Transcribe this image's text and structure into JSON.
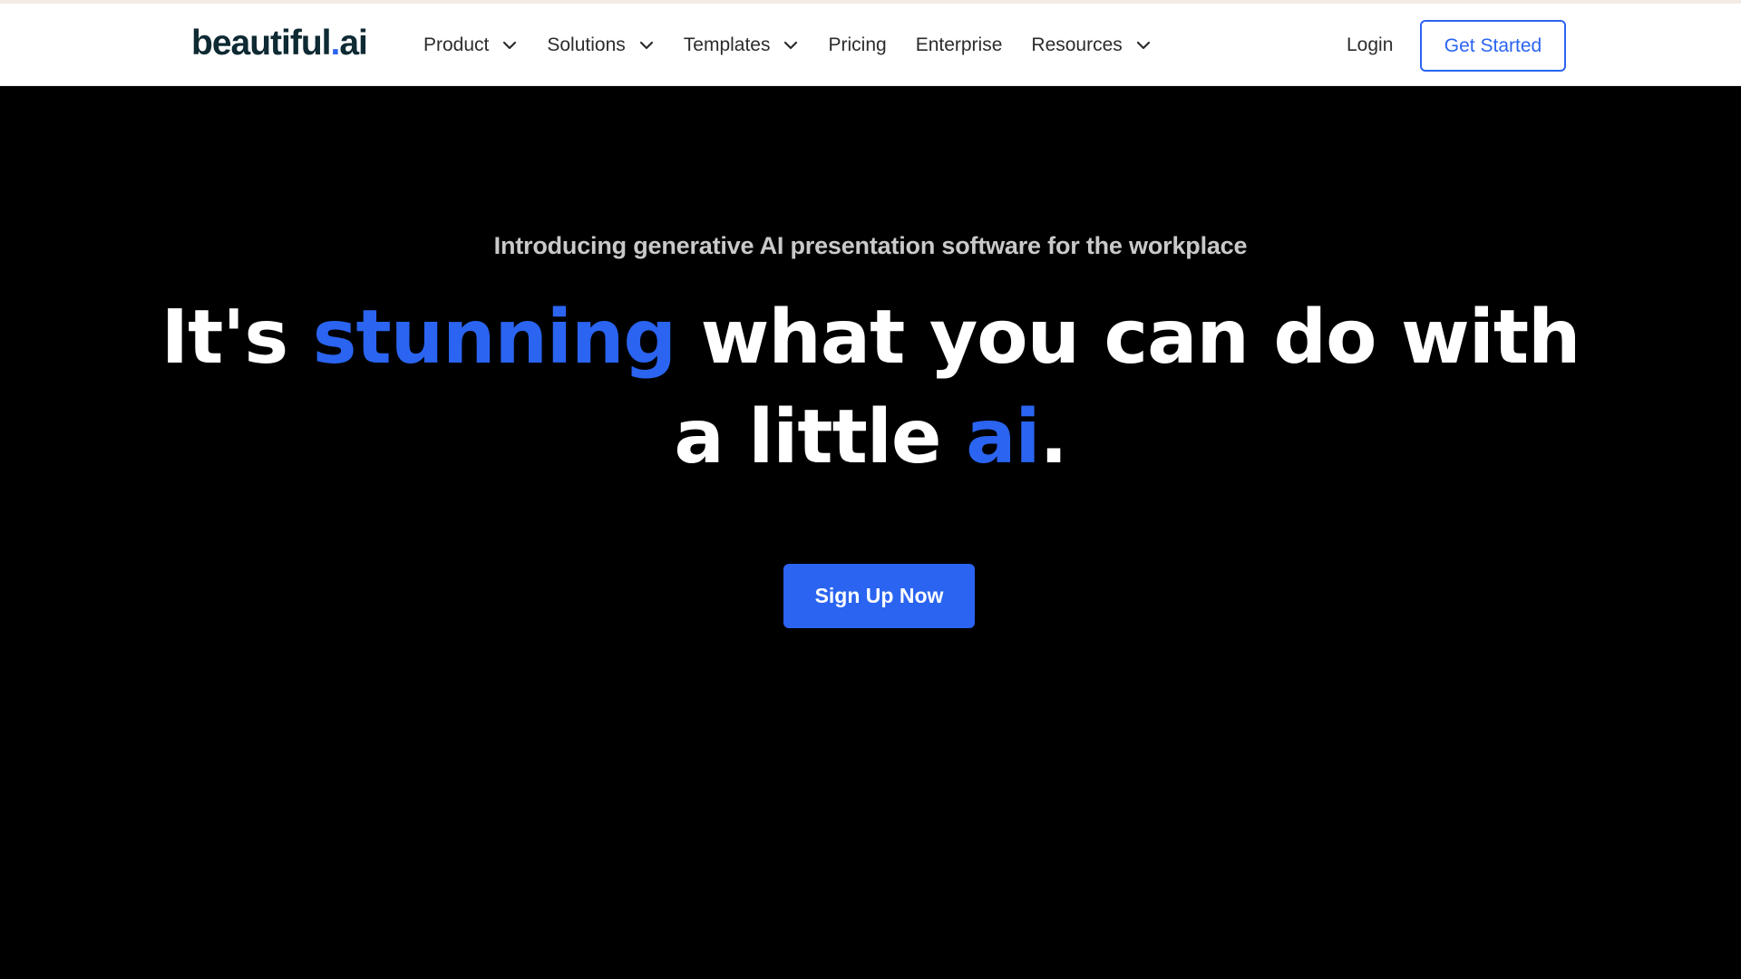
{
  "brand": {
    "name_main": "beautiful",
    "name_dot": ".",
    "name_suffix": "ai"
  },
  "nav": {
    "items": [
      {
        "label": "Product",
        "has_dropdown": true
      },
      {
        "label": "Solutions",
        "has_dropdown": true
      },
      {
        "label": "Templates",
        "has_dropdown": true
      },
      {
        "label": "Pricing",
        "has_dropdown": false
      },
      {
        "label": "Enterprise",
        "has_dropdown": false
      },
      {
        "label": "Resources",
        "has_dropdown": true
      }
    ],
    "login_label": "Login",
    "cta_label": "Get Started"
  },
  "hero": {
    "subtitle": "Introducing generative AI presentation software for the workplace",
    "headline_part1": "It's ",
    "headline_accent1": "stunning",
    "headline_part2": " what you can do with a little ",
    "headline_accent2": "ai",
    "headline_part3": ".",
    "cta_label": "Sign Up Now"
  },
  "colors": {
    "accent": "#2a64f0",
    "background": "#000000",
    "nav_bg": "#ffffff",
    "logo_text": "#0e2a33"
  }
}
